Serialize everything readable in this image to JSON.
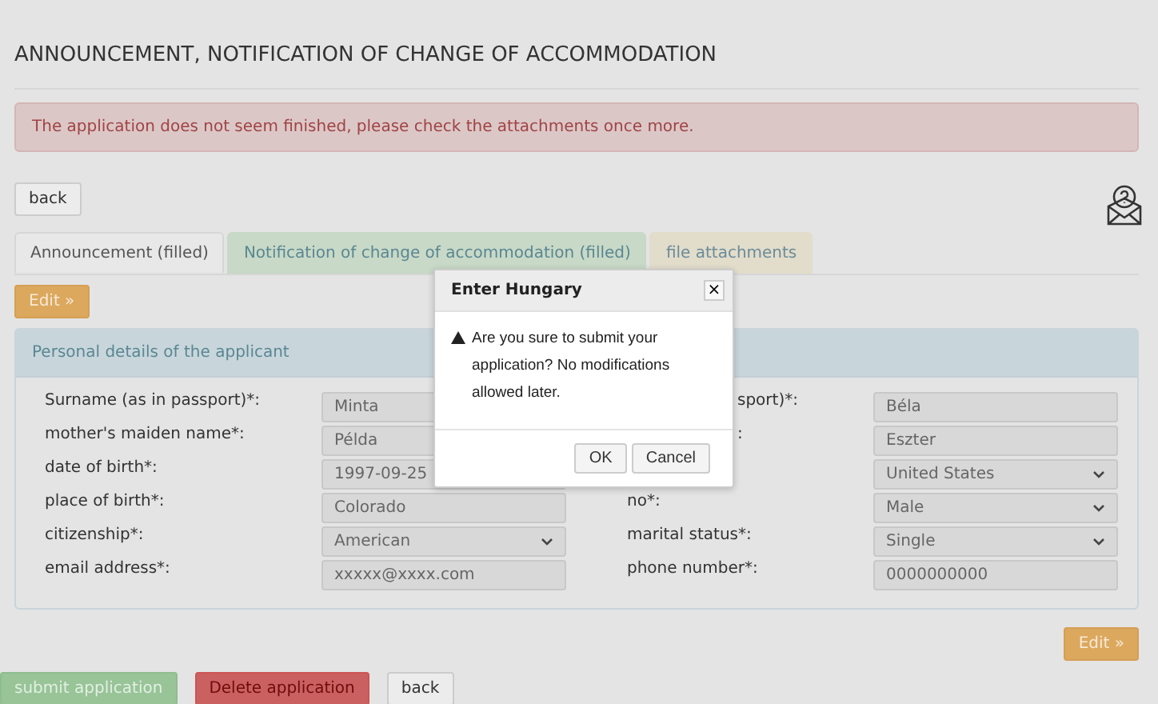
{
  "title": "ANNOUNCEMENT, NOTIFICATION OF CHANGE OF ACCOMMODATION",
  "alert": "The application does not seem finished, please check the attachments once more.",
  "back_top": "back",
  "tabs": [
    {
      "label": "Announcement (filled)",
      "selected": true,
      "kind": "plain"
    },
    {
      "label": "Notification of change of accommodation (filled)",
      "selected": false,
      "kind": "success"
    },
    {
      "label": "file attachments",
      "selected": false,
      "kind": "warning"
    }
  ],
  "edit_top": "Edit »",
  "panel": {
    "title": "Personal details of the applicant",
    "rows": [
      [
        {
          "label": "Surname (as in passport)*:",
          "value": "Minta",
          "kind": "text"
        },
        {
          "label": "sport)*:",
          "covered": true,
          "value": "Béla",
          "kind": "text"
        }
      ],
      [
        {
          "label": "mother's maiden name*:",
          "value": "Példa",
          "kind": "text"
        },
        {
          "label": ":",
          "covered": true,
          "value": "Eszter",
          "kind": "text"
        }
      ],
      [
        {
          "label": "date of birth*:",
          "value": "1997-09-25",
          "kind": "text"
        },
        {
          "value": "United States",
          "kind": "select"
        }
      ],
      [
        {
          "label": "place of birth*:",
          "value": "Colorado",
          "kind": "text"
        },
        {
          "label": "no*:",
          "value": "Male",
          "kind": "select"
        }
      ],
      [
        {
          "label": "citizenship*:",
          "value": "American",
          "kind": "select"
        },
        {
          "label": "marital status*:",
          "value": "Single",
          "kind": "select"
        }
      ],
      [
        {
          "label": "email address*:",
          "value": "xxxxx@xxxx.com",
          "kind": "text"
        },
        {
          "label": "phone number*:",
          "value": "0000000000",
          "kind": "text"
        }
      ]
    ]
  },
  "edit_bottom": "Edit »",
  "bottom_buttons": [
    {
      "label": "submit application",
      "kind": "success"
    },
    {
      "label": "Delete application",
      "kind": "danger"
    },
    {
      "label": "back",
      "kind": "default"
    }
  ],
  "dialog": {
    "title": "Enter Hungary",
    "close": "×",
    "message": "Are you sure to submit your application? No modifications allowed later.",
    "buttons": [
      "OK",
      "Cancel"
    ]
  }
}
